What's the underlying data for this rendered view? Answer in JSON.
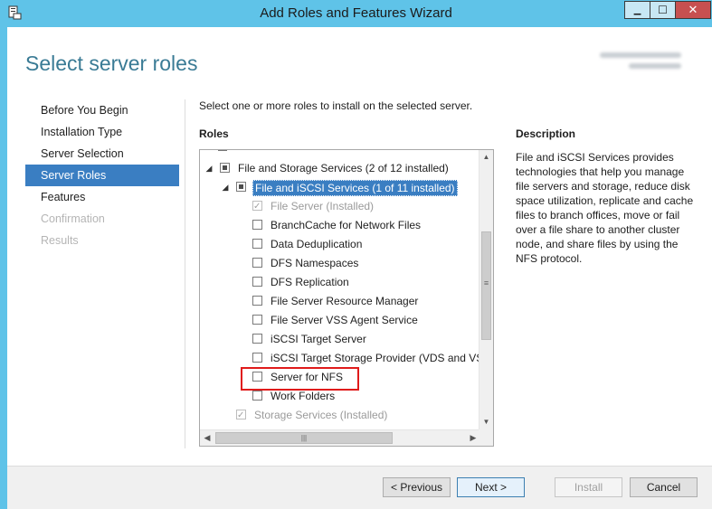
{
  "window": {
    "title": "Add Roles and Features Wizard",
    "controls": {
      "minimize": "▁",
      "maximize": "☐",
      "close": "✕"
    },
    "icon": "server-manager-icon"
  },
  "header": {
    "page_title": "Select server roles"
  },
  "nav": {
    "items": [
      {
        "label": "Before You Begin",
        "state": "normal"
      },
      {
        "label": "Installation Type",
        "state": "normal"
      },
      {
        "label": "Server Selection",
        "state": "normal"
      },
      {
        "label": "Server Roles",
        "state": "active"
      },
      {
        "label": "Features",
        "state": "normal"
      },
      {
        "label": "Confirmation",
        "state": "disabled"
      },
      {
        "label": "Results",
        "state": "disabled"
      }
    ]
  },
  "content": {
    "instruction": "Select one or more roles to install on the selected server.",
    "roles_label": "Roles",
    "description_label": "Description",
    "description_text": "File and iSCSI Services provides technologies that help you manage file servers and storage, reduce disk space utilization, replicate and cache files to branch offices, move or fail over a file share to another cluster node, and share files by using the NFS protocol."
  },
  "roles_tree": [
    {
      "label": "File and Storage Services (2 of 12 installed)",
      "checkbox": "partial",
      "expander": "◢",
      "level": 0
    },
    {
      "label": "File and iSCSI Services (1 of 11 installed)",
      "checkbox": "partial",
      "expander": "◢",
      "level": 1,
      "selected": true
    },
    {
      "label": "File Server (Installed)",
      "checkbox": "checked-disabled",
      "level": 2
    },
    {
      "label": "BranchCache for Network Files",
      "checkbox": "unchecked",
      "level": 2
    },
    {
      "label": "Data Deduplication",
      "checkbox": "unchecked",
      "level": 2
    },
    {
      "label": "DFS Namespaces",
      "checkbox": "unchecked",
      "level": 2
    },
    {
      "label": "DFS Replication",
      "checkbox": "unchecked",
      "level": 2
    },
    {
      "label": "File Server Resource Manager",
      "checkbox": "unchecked",
      "level": 2
    },
    {
      "label": "File Server VSS Agent Service",
      "checkbox": "unchecked",
      "level": 2
    },
    {
      "label": "iSCSI Target Server",
      "checkbox": "unchecked",
      "level": 2
    },
    {
      "label": "iSCSI Target Storage Provider (VDS and VSS",
      "checkbox": "unchecked",
      "level": 2
    },
    {
      "label": "Server for NFS",
      "checkbox": "unchecked",
      "level": 2,
      "highlighted": true
    },
    {
      "label": "Work Folders",
      "checkbox": "unchecked",
      "level": 2
    },
    {
      "label": "Storage Services (Installed)",
      "checkbox": "checked-disabled",
      "level": 1
    }
  ],
  "scroll": {
    "up": "▲",
    "down": "▼",
    "left": "◀",
    "right": "▶",
    "grip_v": "≡",
    "grip_h": "|||"
  },
  "footer": {
    "previous": "< Previous",
    "next": "Next >",
    "install": "Install",
    "cancel": "Cancel"
  },
  "colors": {
    "titlebar": "#5fc3e8",
    "accent": "#3a7ec2",
    "header_text": "#3a7b95",
    "highlight": "#e01b1b"
  }
}
